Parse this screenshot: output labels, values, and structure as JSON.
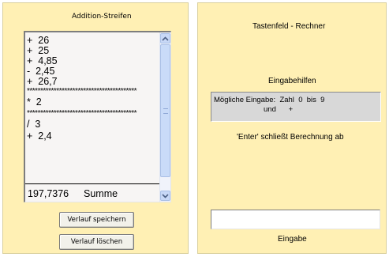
{
  "left_panel": {
    "title": "Addition-Streifen",
    "strip_lines": [
      "+  26",
      "+  25",
      "+  4,85",
      "-  2,45",
      "+  26,7",
      "*****************************************",
      "*  2",
      "*****************************************",
      "/  3",
      "+  2,4"
    ],
    "sum_value": "197,7376",
    "sum_label": "Summe",
    "save_button": "Verlauf speichern",
    "clear_button": "Verlauf löschen"
  },
  "right_panel": {
    "title": "Tastenfeld - Rechner",
    "hints_title": "Eingabehilfen",
    "hints_line1": "Mögliche Eingabe:  Zahl  0  bis  9",
    "hints_line2": "und      +",
    "enter_note": "'Enter' schließt Berechnung ab",
    "input_value": "",
    "input_label": "Eingabe"
  },
  "colors": {
    "panel_background": "#fff0b4",
    "hints_background": "#d8d8d8",
    "scrollbar_accent": "#c8d8f6"
  },
  "icons": {
    "scroll_up": "chevron-up-icon",
    "scroll_down": "chevron-down-icon"
  }
}
